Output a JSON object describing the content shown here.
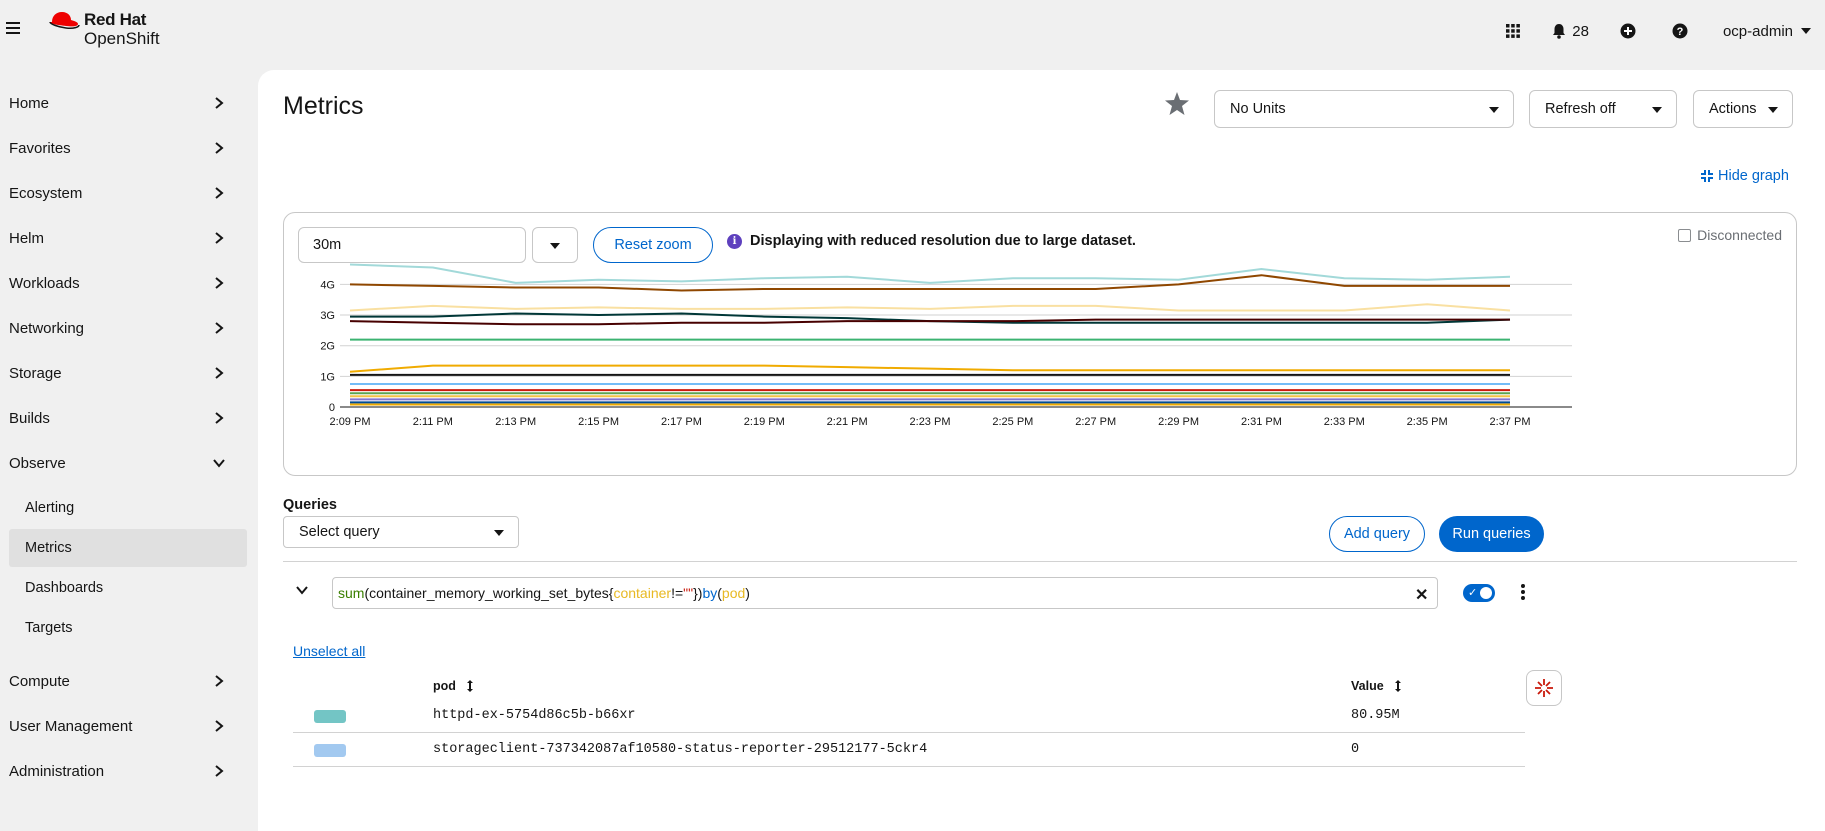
{
  "brand": {
    "line1": "Red Hat",
    "line2": "OpenShift"
  },
  "masthead": {
    "notification_count": "28",
    "user": "ocp-admin"
  },
  "sidebar": {
    "items": [
      {
        "label": "Home"
      },
      {
        "label": "Favorites"
      },
      {
        "label": "Ecosystem"
      },
      {
        "label": "Helm"
      },
      {
        "label": "Workloads"
      },
      {
        "label": "Networking"
      },
      {
        "label": "Storage"
      },
      {
        "label": "Builds"
      },
      {
        "label": "Observe"
      },
      {
        "label": "Compute"
      },
      {
        "label": "User Management"
      },
      {
        "label": "Administration"
      }
    ],
    "observe_sub": [
      {
        "label": "Alerting"
      },
      {
        "label": "Metrics"
      },
      {
        "label": "Dashboards"
      },
      {
        "label": "Targets"
      }
    ]
  },
  "page": {
    "title": "Metrics",
    "units_select": "No Units",
    "refresh_select": "Refresh off",
    "actions_label": "Actions",
    "hide_graph": "Hide graph"
  },
  "graph": {
    "time_range": "30m",
    "reset_zoom": "Reset zoom",
    "info_message": "Displaying with reduced resolution due to large dataset.",
    "disconnected_label": "Disconnected"
  },
  "chart_data": {
    "type": "line",
    "x": [
      "2:09 PM",
      "2:11 PM",
      "2:13 PM",
      "2:15 PM",
      "2:17 PM",
      "2:19 PM",
      "2:21 PM",
      "2:23 PM",
      "2:25 PM",
      "2:27 PM",
      "2:29 PM",
      "2:31 PM",
      "2:33 PM",
      "2:35 PM",
      "2:37 PM"
    ],
    "y_ticks": [
      "0",
      "1G",
      "2G",
      "3G",
      "4G"
    ],
    "ylim": [
      0,
      4.6
    ],
    "grid": true,
    "series": [
      {
        "color": "#a2d9d9",
        "values": [
          4.65,
          4.55,
          4.05,
          4.15,
          4.1,
          4.2,
          4.25,
          4.05,
          4.2,
          4.2,
          4.15,
          4.5,
          4.2,
          4.15,
          4.25
        ]
      },
      {
        "color": "#8f4700",
        "values": [
          4.0,
          3.95,
          3.9,
          3.9,
          3.8,
          3.85,
          3.85,
          3.85,
          3.85,
          3.85,
          4.0,
          4.3,
          3.95,
          3.95,
          3.95
        ]
      },
      {
        "color": "#f9e0a2",
        "values": [
          3.15,
          3.3,
          3.2,
          3.25,
          3.2,
          3.2,
          3.25,
          3.2,
          3.3,
          3.3,
          3.15,
          3.15,
          3.15,
          3.35,
          3.15
        ]
      },
      {
        "color": "#003737",
        "values": [
          2.95,
          2.95,
          3.05,
          3.0,
          3.05,
          2.95,
          2.9,
          2.8,
          2.75,
          2.75,
          2.75,
          2.75,
          2.75,
          2.75,
          2.85
        ]
      },
      {
        "color": "#470000",
        "values": [
          2.8,
          2.75,
          2.7,
          2.7,
          2.75,
          2.75,
          2.8,
          2.8,
          2.8,
          2.85,
          2.85,
          2.85,
          2.85,
          2.85,
          2.85
        ]
      },
      {
        "color": "#3cb371",
        "values": [
          2.2,
          2.2,
          2.2,
          2.2,
          2.2,
          2.2,
          2.2,
          2.2,
          2.2,
          2.2,
          2.2,
          2.2,
          2.2,
          2.2,
          2.2
        ]
      },
      {
        "color": "#f0ab00",
        "values": [
          1.15,
          1.35,
          1.35,
          1.35,
          1.35,
          1.35,
          1.3,
          1.25,
          1.2,
          1.2,
          1.2,
          1.2,
          1.2,
          1.2,
          1.2
        ]
      },
      {
        "color": "#151515",
        "values": [
          1.05,
          1.05,
          1.05,
          1.05,
          1.05,
          1.05,
          1.05,
          1.05,
          1.05,
          1.05,
          1.05,
          1.05,
          1.05,
          1.05,
          1.05
        ]
      },
      {
        "color": "#73bcf7",
        "values": [
          0.75,
          0.75,
          0.75,
          0.75,
          0.75,
          0.75,
          0.75,
          0.75,
          0.75,
          0.75,
          0.75,
          0.75,
          0.75,
          0.75,
          0.75
        ]
      },
      {
        "color": "#c9190b",
        "values": [
          0.55,
          0.55,
          0.55,
          0.55,
          0.55,
          0.55,
          0.55,
          0.55,
          0.55,
          0.55,
          0.55,
          0.55,
          0.55,
          0.55,
          0.55
        ]
      },
      {
        "color": "#5ba352",
        "values": [
          0.45,
          0.45,
          0.45,
          0.45,
          0.45,
          0.45,
          0.45,
          0.45,
          0.45,
          0.45,
          0.45,
          0.45,
          0.45,
          0.45,
          0.45
        ]
      },
      {
        "color": "#f4c145",
        "values": [
          0.35,
          0.35,
          0.35,
          0.35,
          0.35,
          0.35,
          0.35,
          0.35,
          0.35,
          0.35,
          0.35,
          0.35,
          0.35,
          0.35,
          0.35
        ]
      },
      {
        "color": "#8476d1",
        "values": [
          0.25,
          0.25,
          0.25,
          0.25,
          0.25,
          0.25,
          0.25,
          0.25,
          0.25,
          0.25,
          0.25,
          0.25,
          0.25,
          0.25,
          0.25
        ]
      },
      {
        "color": "#004b95",
        "values": [
          0.15,
          0.15,
          0.15,
          0.15,
          0.15,
          0.15,
          0.15,
          0.15,
          0.15,
          0.15,
          0.15,
          0.15,
          0.15,
          0.15,
          0.15
        ]
      },
      {
        "color": "#f0ab00",
        "values": [
          0.08,
          0.08,
          0.08,
          0.08,
          0.08,
          0.08,
          0.08,
          0.08,
          0.08,
          0.08,
          0.08,
          0.08,
          0.08,
          0.08,
          0.08
        ]
      }
    ]
  },
  "queries": {
    "label": "Queries",
    "select_placeholder": "Select query",
    "add_query": "Add query",
    "run_queries": "Run queries",
    "expression": {
      "fn": "sum",
      "open": "(container_memory_working_set_bytes{",
      "label": "container",
      "op": "!=",
      "str": "\"\"",
      "close": "}) ",
      "by": "by",
      "paren_open": " (",
      "by_label": "pod",
      "paren_close": ")"
    },
    "unselect_all": "Unselect all"
  },
  "table": {
    "headers": {
      "pod": "pod",
      "value": "Value"
    },
    "rows": [
      {
        "pod": "httpd-ex-5754d86c5b-b66xr",
        "value": "80.95M",
        "color": "#73c5c5"
      },
      {
        "pod": "storageclient-737342087af10580-status-reporter-29512177-5ckr4",
        "value": "0",
        "color": "#a2c9f0"
      }
    ]
  },
  "colors": {
    "accent": "#0066cc",
    "brand_red": "#ee0000"
  }
}
